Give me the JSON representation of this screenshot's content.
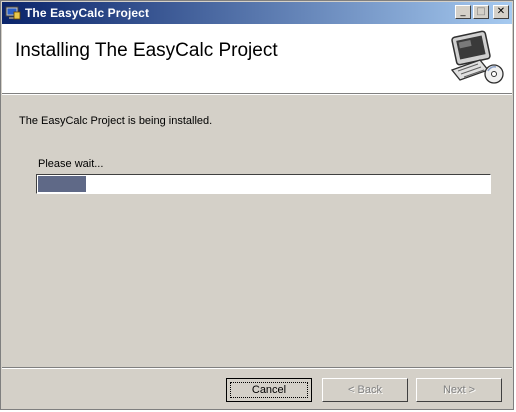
{
  "window": {
    "title": "The EasyCalc Project",
    "controls": {
      "minimize": "_",
      "maximize": "□",
      "close": "✕"
    }
  },
  "banner": {
    "heading": "Installing The EasyCalc Project",
    "art_icon": "computer-setup-icon"
  },
  "content": {
    "status_message": "The EasyCalc Project  is being installed.",
    "wait_label": "Please wait...",
    "progress_fraction": 0.11
  },
  "buttons": {
    "cancel": "Cancel",
    "back": "< Back",
    "next": "Next >"
  },
  "colors": {
    "title_bar_start": "#0a246a",
    "title_bar_end": "#a6caf0",
    "dialog_face": "#d4d0c8",
    "progress_fill": "#5f6987"
  }
}
